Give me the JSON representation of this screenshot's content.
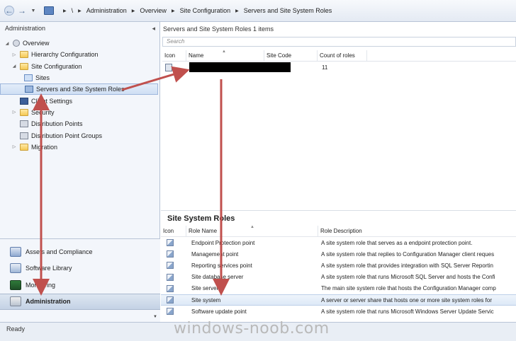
{
  "breadcrumb": {
    "root": "\\",
    "items": [
      "Administration",
      "Overview",
      "Site Configuration",
      "Servers and Site System Roles"
    ]
  },
  "left_pane": {
    "title": "Administration",
    "tree": [
      {
        "label": "Overview",
        "icon": "overview-icon",
        "expander": "expanded"
      },
      {
        "label": "Hierarchy Configuration",
        "icon": "folder-icon",
        "expander": "collapsed"
      },
      {
        "label": "Site Configuration",
        "icon": "folder-icon",
        "expander": "expanded"
      },
      {
        "label": "Sites",
        "icon": "sites-icon",
        "expander": "none"
      },
      {
        "label": "Servers and Site System Roles",
        "icon": "server-icon",
        "expander": "none",
        "selected": true
      },
      {
        "label": "Client Settings",
        "icon": "monitor-icon",
        "expander": "none"
      },
      {
        "label": "Security",
        "icon": "folder-icon",
        "expander": "collapsed"
      },
      {
        "label": "Distribution Points",
        "icon": "distribution-point-icon",
        "expander": "none"
      },
      {
        "label": "Distribution Point Groups",
        "icon": "distribution-point-group-icon",
        "expander": "none"
      },
      {
        "label": "Migration",
        "icon": "folder-icon",
        "expander": "collapsed"
      }
    ],
    "workspaces": [
      {
        "label": "Assets and Compliance",
        "icon": "assets-icon"
      },
      {
        "label": "Software Library",
        "icon": "software-library-icon"
      },
      {
        "label": "Monitoring",
        "icon": "monitoring-icon"
      },
      {
        "label": "Administration",
        "icon": "administration-icon",
        "active": true
      }
    ]
  },
  "servers": {
    "header": "Servers and Site System Roles 1 items",
    "search_placeholder": "Search",
    "columns": [
      "Icon",
      "Name",
      "Site Code",
      "Count of roles"
    ],
    "rows": [
      {
        "icon": "server-icon",
        "name": "",
        "site_code": "",
        "count_of_roles": "11"
      }
    ]
  },
  "roles": {
    "title": "Site System Roles",
    "columns": [
      "Icon",
      "Role Name",
      "Role Description"
    ],
    "rows": [
      {
        "name": "Endpoint Protection point",
        "desc": "A site system role that serves as a endpoint protection point."
      },
      {
        "name": "Management point",
        "desc": "A site system role that replies to Configuration Manager client reques"
      },
      {
        "name": "Reporting services point",
        "desc": "A site system role that  provides integration with SQL Server Reportin"
      },
      {
        "name": "Site database server",
        "desc": "A site system role that runs Microsoft SQL Server and hosts the Confi"
      },
      {
        "name": "Site server",
        "desc": "The main site system role that hosts the Configuration Manager comp"
      },
      {
        "name": "Site system",
        "desc": "A server or server share that hosts one or more site system roles for",
        "selected": true
      },
      {
        "name": "Software update point",
        "desc": "A site system role that runs Microsoft Windows Server Update Servic"
      }
    ]
  },
  "status": "Ready",
  "watermark": "windows-noob.com",
  "colors": {
    "annotation_arrow": "#c0504d",
    "selection": "#cfdff4"
  }
}
